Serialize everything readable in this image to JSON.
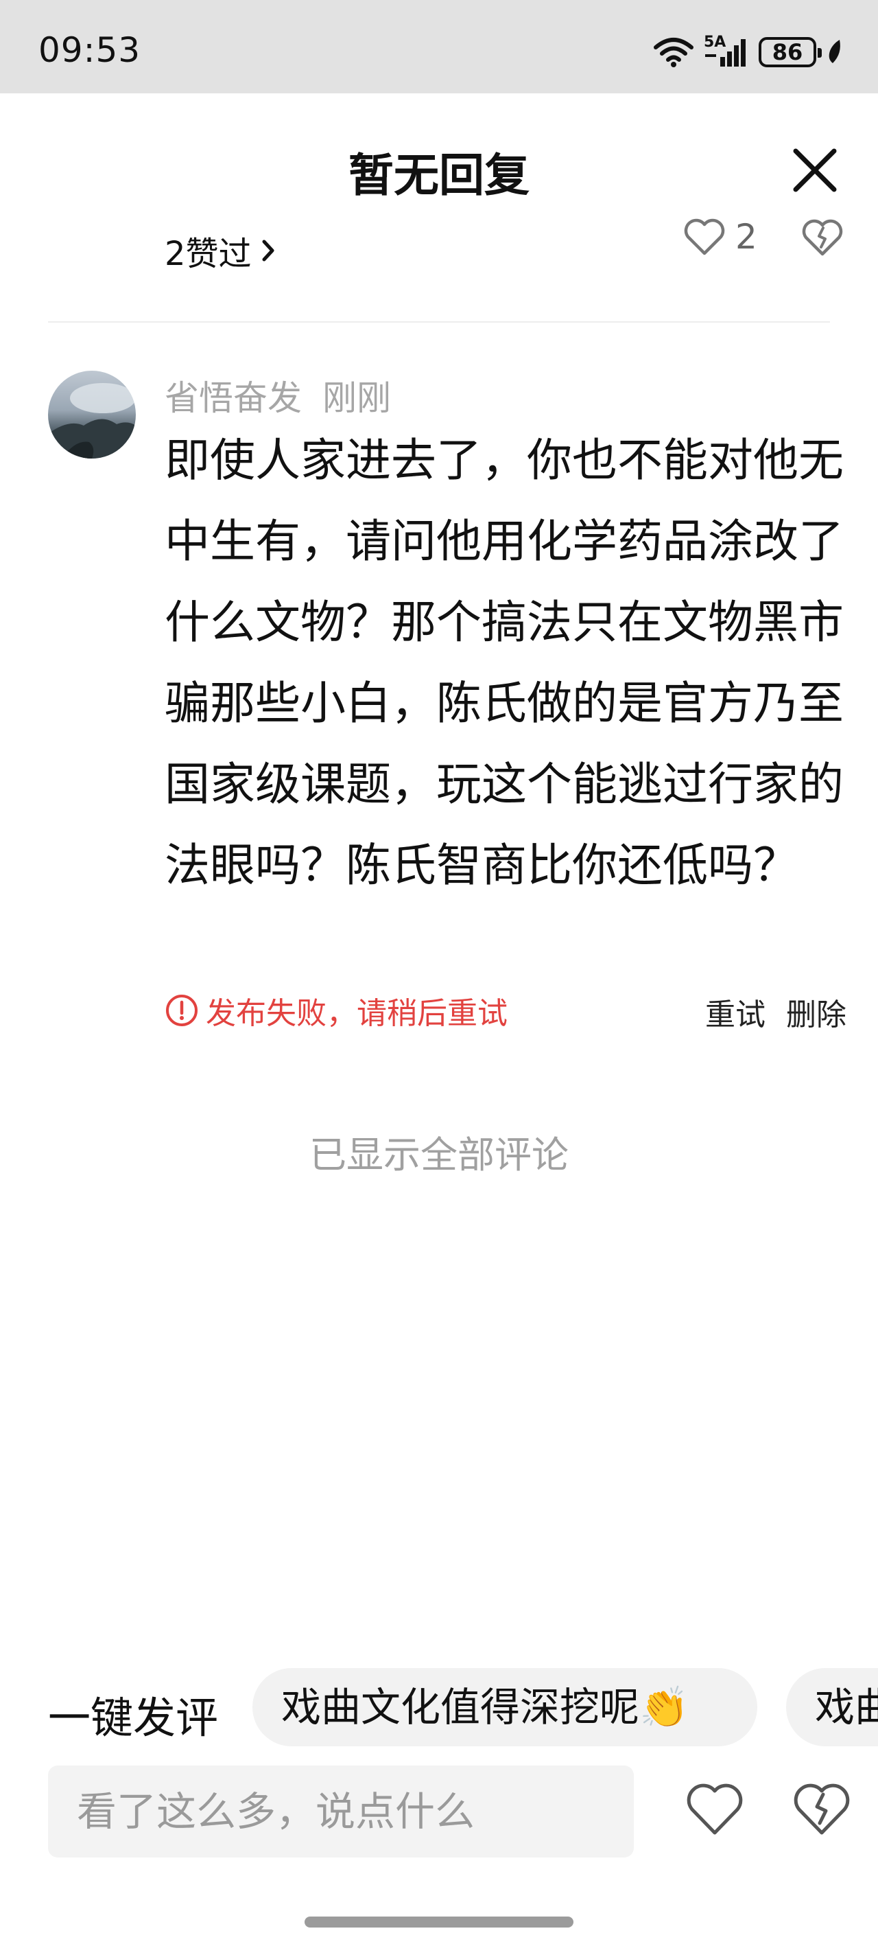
{
  "status_bar": {
    "time": "09:53",
    "network": "5A",
    "battery": "86",
    "icons": [
      "wifi-icon",
      "signal-icon",
      "battery-icon",
      "leaf-icon"
    ]
  },
  "header": {
    "title": "暂无回复",
    "close_icon": "close-icon"
  },
  "parent": {
    "likes_text": "2赞过",
    "like_count": "2"
  },
  "comment": {
    "author": "省悟奋发",
    "time": "刚刚",
    "text": "即使人家进去了，你也不能对他无中生有，请问他用化学药品涂改了什么文物？那个搞法只在文物黑市骗那些小白，陈氏做的是官方乃至国家级课题，玩这个能逃过行家的法眼吗？陈氏智商比你还低吗？",
    "fail_text": "发布失败，请稍后重试",
    "retry_label": "重试",
    "delete_label": "删除"
  },
  "footer_note": "已显示全部评论",
  "quick_comment": {
    "label": "一键发评",
    "chips": [
      "戏曲文化值得深挖呢👏",
      "戏曲"
    ]
  },
  "input": {
    "placeholder": "看了这么多，说点什么"
  },
  "colors": {
    "error": "#e2423f",
    "muted": "#a0a0a0",
    "status_bar_bg": "#e2e2e2"
  }
}
